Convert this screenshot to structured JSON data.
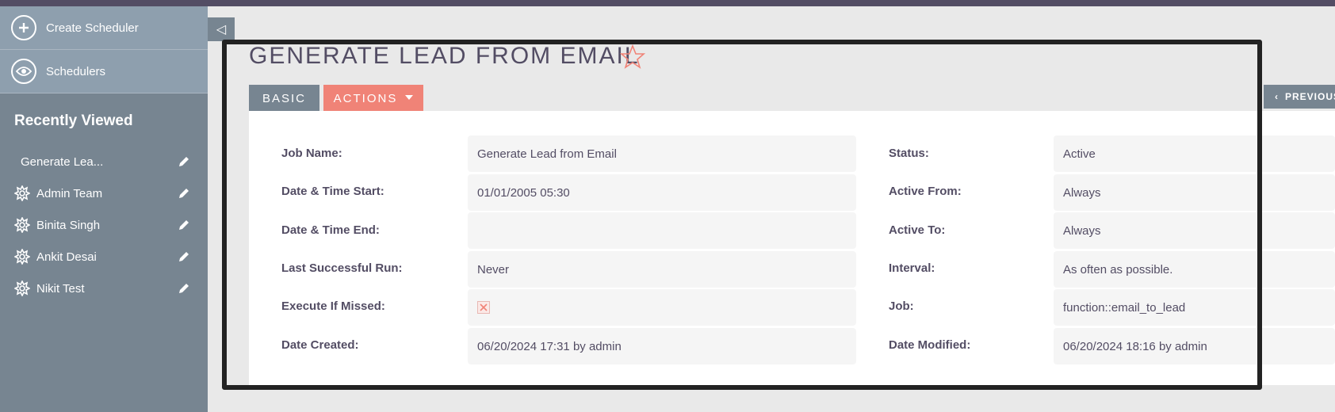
{
  "sidebar": {
    "actions": [
      {
        "label": "Create Scheduler",
        "icon": "plus-icon"
      },
      {
        "label": "Schedulers",
        "icon": "eye-icon"
      }
    ],
    "recent_title": "Recently Viewed",
    "recent": [
      {
        "label": "Generate Lea...",
        "icon": "none"
      },
      {
        "label": "Admin Team",
        "icon": "gear-icon"
      },
      {
        "label": "Binita Singh",
        "icon": "gear-icon"
      },
      {
        "label": "Ankit Desai",
        "icon": "gear-icon"
      },
      {
        "label": "Nikit Test",
        "icon": "gear-icon"
      }
    ]
  },
  "toggle_glyph": "◁",
  "header": {
    "title": "GENERATE LEAD FROM EMAIL",
    "tabs": {
      "basic": "BASIC",
      "actions": "ACTIONS"
    },
    "previous": "PREVIOUS"
  },
  "fields": {
    "left": [
      {
        "label": "Job Name:",
        "value": "Generate Lead from Email"
      },
      {
        "label": "Date & Time Start:",
        "value": "01/01/2005 05:30"
      },
      {
        "label": "Date & Time End:",
        "value": ""
      },
      {
        "label": "Last Successful Run:",
        "value": "Never"
      },
      {
        "label": "Execute If Missed:",
        "value": ""
      },
      {
        "label": "Date Created:",
        "value": "06/20/2024 17:31 by admin"
      }
    ],
    "right": [
      {
        "label": "Status:",
        "value": "Active"
      },
      {
        "label": "Active From:",
        "value": "Always"
      },
      {
        "label": "Active To:",
        "value": "Always"
      },
      {
        "label": "Interval:",
        "value": "As often as possible."
      },
      {
        "label": "Job:",
        "value": "function::email_to_lead"
      },
      {
        "label": "Date Modified:",
        "value": "06/20/2024 18:16 by admin"
      }
    ]
  },
  "colors": {
    "accent": "#f08377",
    "sidebar": "#778591",
    "text": "#534d64"
  }
}
